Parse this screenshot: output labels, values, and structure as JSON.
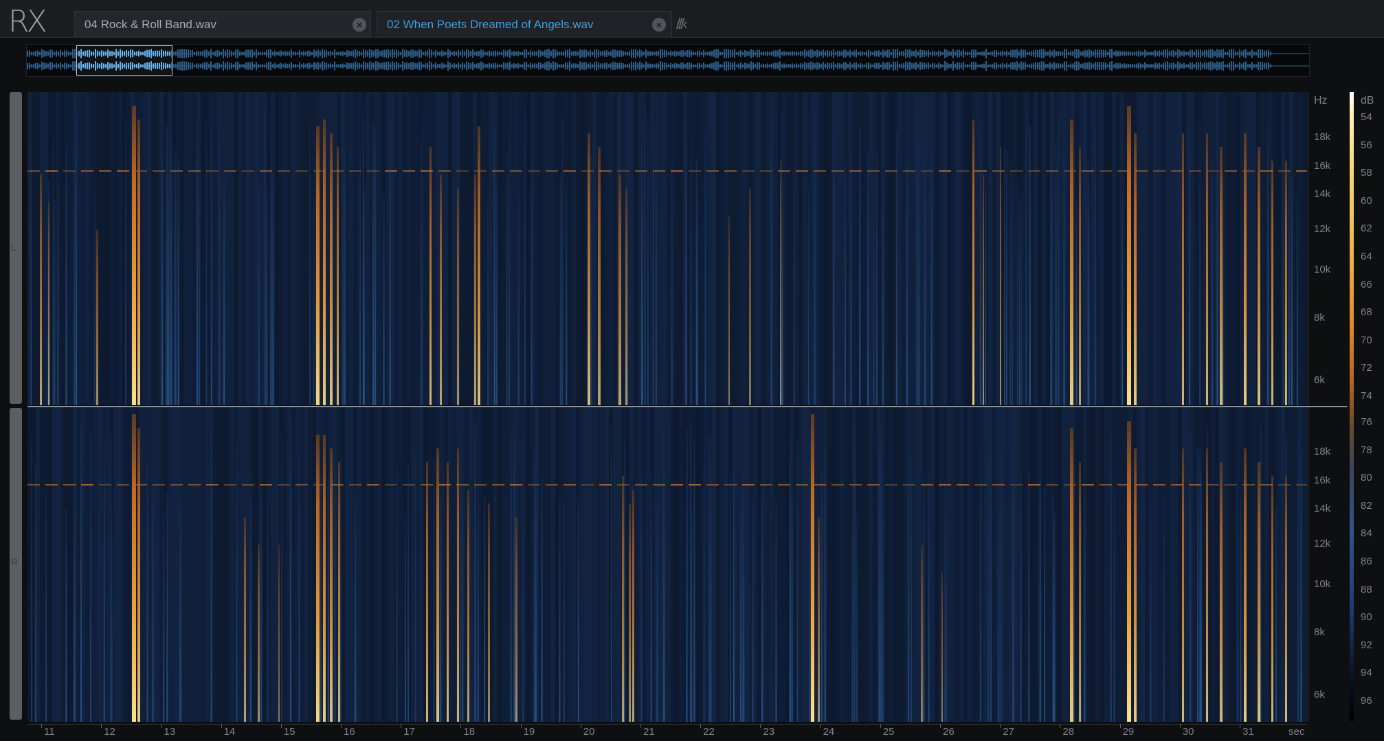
{
  "app": {
    "logo": "RX"
  },
  "tabs": [
    {
      "label": "04 Rock & Roll Band.wav",
      "active": false
    },
    {
      "label": "02 When Poets Dreamed of Angels.wav",
      "active": true
    }
  ],
  "channels": {
    "left": "L",
    "right": "R"
  },
  "frequency_axis": {
    "unit": "Hz",
    "ticks": [
      "18k",
      "16k",
      "14k",
      "12k",
      "10k",
      "8k",
      "6k"
    ]
  },
  "db_scale": {
    "unit": "dB",
    "ticks": [
      "54",
      "56",
      "58",
      "60",
      "62",
      "64",
      "66",
      "68",
      "70",
      "72",
      "74",
      "76",
      "78",
      "80",
      "82",
      "84",
      "86",
      "88",
      "90",
      "92",
      "94",
      "96"
    ]
  },
  "time_axis": {
    "unit": "sec",
    "ticks": [
      "11",
      "12",
      "13",
      "14",
      "15",
      "16",
      "17",
      "18",
      "19",
      "20",
      "21",
      "22",
      "23",
      "24",
      "25",
      "26",
      "27",
      "28",
      "29",
      "30",
      "31"
    ]
  },
  "colors": {
    "accent": "#3e9fe0",
    "hot": "#f0a23a",
    "cool": "#1c355e"
  },
  "icons": {
    "close": "close-icon",
    "tab_overflow": "tab-overflow-icon"
  }
}
